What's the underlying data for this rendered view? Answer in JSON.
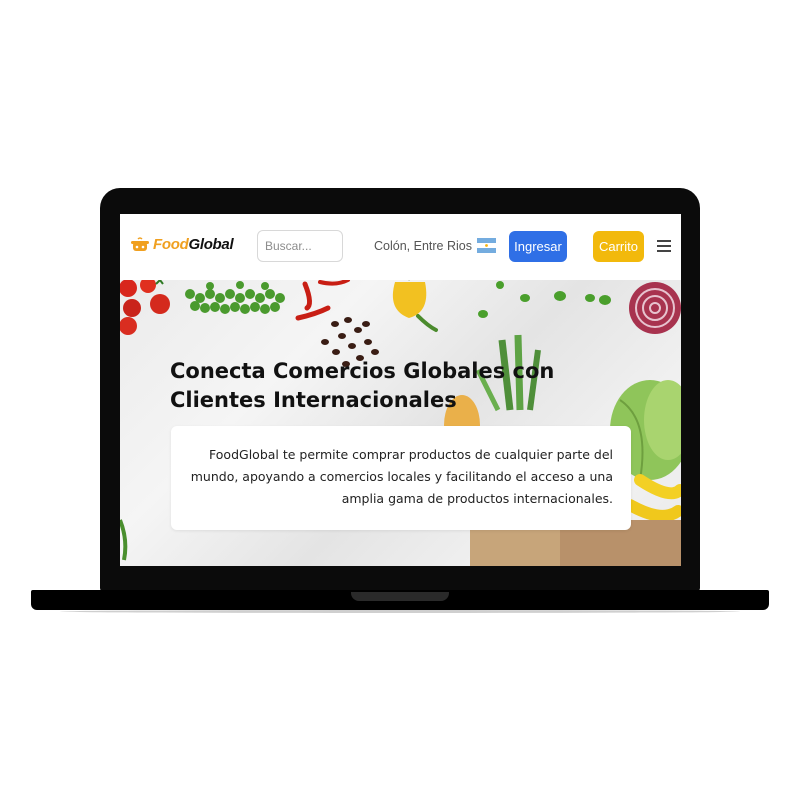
{
  "navbar": {
    "logo": {
      "part1": "Food",
      "part2": "Global",
      "icon": "cooking-pot-icon"
    },
    "search": {
      "placeholder": "Buscar...",
      "value": ""
    },
    "location": "Colón, Entre Rios",
    "flag": "argentina-flag-icon",
    "login_label": "Ingresar",
    "cart_label": "Carrito",
    "menu_icon": "hamburger-menu-icon"
  },
  "hero": {
    "title": "Conecta Comercios Globales con Clientes Internacionales",
    "description": "FoodGlobal te permite comprar productos de cualquier parte del mundo, apoyando a comercios locales y facilitando el acceso a una amplia gama de productos internacionales."
  },
  "colors": {
    "login_button": "#2f6fe6",
    "cart_button": "#f2b90c",
    "logo_accent": "#f0a020",
    "laptop_bezel": "#0b0b0b"
  }
}
